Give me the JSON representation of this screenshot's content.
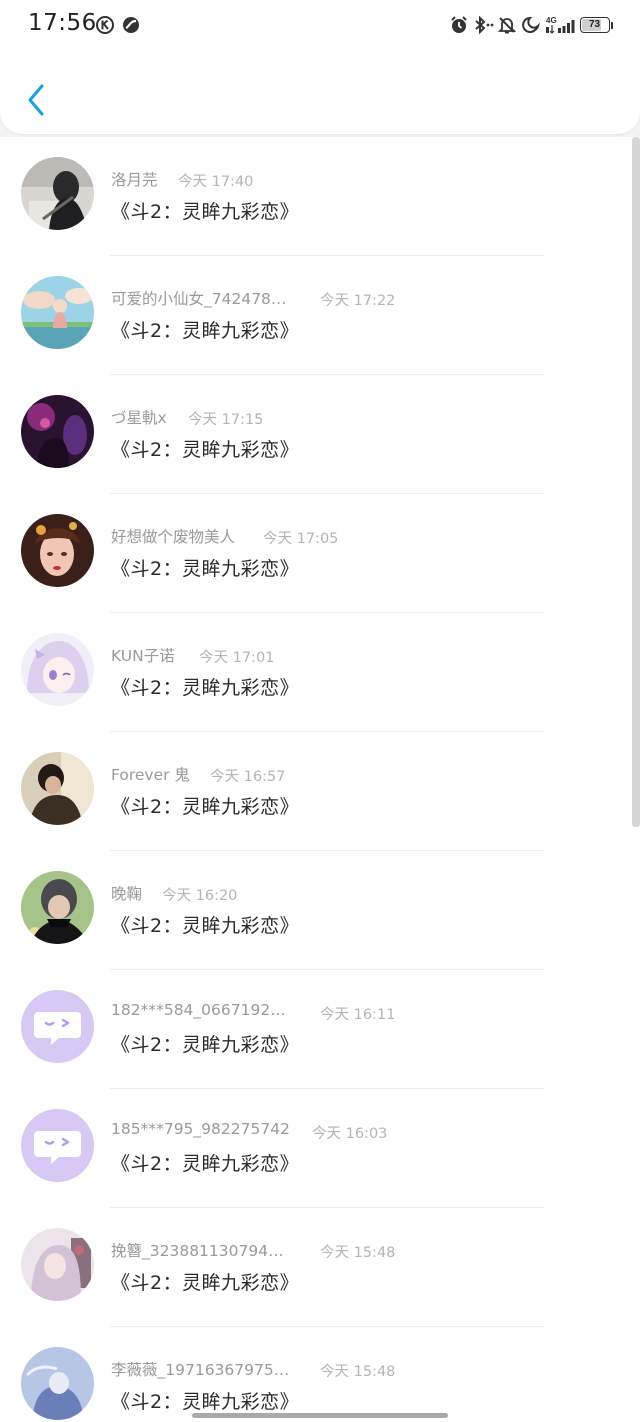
{
  "status_bar": {
    "time": "17:56",
    "network": "4G",
    "battery": "73"
  },
  "header": {
    "back_icon": "chevron-left-icon",
    "accent_color": "#1a9ce8"
  },
  "messages": [
    {
      "name": "洛月芫",
      "time": "今天 17:40",
      "text": "《斗2：灵眸九彩恋》"
    },
    {
      "name": "可爱的小仙女_742478…",
      "time": "今天 17:22",
      "text": "《斗2：灵眸九彩恋》"
    },
    {
      "name": "づ星軌x",
      "time": "今天 17:15",
      "text": "《斗2：灵眸九彩恋》"
    },
    {
      "name": "好想做个废物美人",
      "time": "今天 17:05",
      "text": "《斗2：灵眸九彩恋》"
    },
    {
      "name": "KUN子诺",
      "time": "今天 17:01",
      "text": "《斗2：灵眸九彩恋》"
    },
    {
      "name": "Forever 鬼",
      "time": "今天 16:57",
      "text": "《斗2：灵眸九彩恋》"
    },
    {
      "name": "晚鞠",
      "time": "今天 16:20",
      "text": "《斗2：灵眸九彩恋》"
    },
    {
      "name": "182***584_0667192…",
      "time": "今天 16:11",
      "text": "《斗2：灵眸九彩恋》"
    },
    {
      "name": "185***795_982275742",
      "time": "今天 16:03",
      "text": "《斗2：灵眸九彩恋》"
    },
    {
      "name": "挽簪_323881130794…",
      "time": "今天 15:48",
      "text": "《斗2：灵眸九彩恋》"
    },
    {
      "name": "李薇薇_19716367975…",
      "time": "今天 15:48",
      "text": "《斗2：灵眸九彩恋》"
    }
  ]
}
